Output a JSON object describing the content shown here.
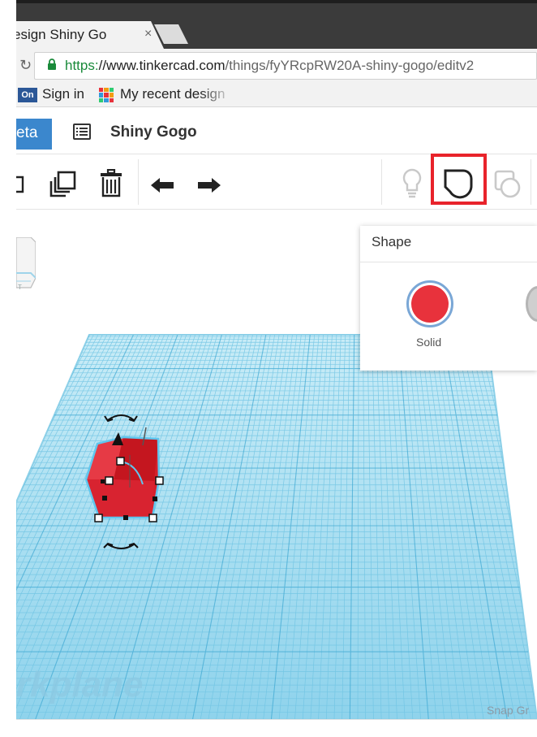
{
  "browser": {
    "tab_title": "esign Shiny Go",
    "tab_close": "×",
    "reload": "↻",
    "url_scheme": "https:",
    "url_host": "//www.tinkercad.com",
    "url_path": "/things/fyYRcpRW20A-shiny-gogo/editv2"
  },
  "bookmarks": [
    {
      "icon_text": "On",
      "label": "Sign in"
    },
    {
      "icon": "tinkercad-grid-icon",
      "label": "My recent design"
    }
  ],
  "header": {
    "badge": "eta",
    "design_title": "Shiny Gogo"
  },
  "toolbar": {
    "icons": [
      "copy-icon",
      "duplicate-icon",
      "delete-icon",
      "undo-icon",
      "redo-icon",
      "lightbulb-icon",
      "shape-icon",
      "hole-icon"
    ],
    "highlight_color": "#e8232b"
  },
  "shape_panel": {
    "title": "Shape",
    "solid_label": "Solid",
    "solid_color": "#e8323c"
  },
  "workplane": {
    "label": "rkplane",
    "snap": "Snap Gr"
  },
  "colors": {
    "grid": "#7fd0ea",
    "grid_fill": "#a9def0",
    "accent": "#3b87cd"
  }
}
